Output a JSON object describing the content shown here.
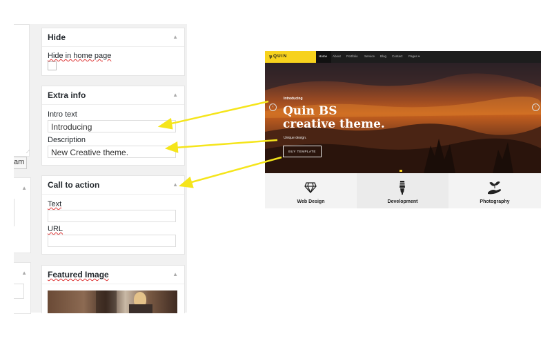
{
  "cut_off_text": "am",
  "metaboxes": {
    "hide": {
      "title": "Hide",
      "checkbox_label": "Hide in home page"
    },
    "extra_info": {
      "title": "Extra info",
      "intro_label": "Intro text",
      "intro_value": "Introducing",
      "description_label": "Description",
      "description_value": "New Creative theme."
    },
    "call_to_action": {
      "title": "Call to action",
      "text_label": "Text",
      "text_value": "",
      "url_label": "URL",
      "url_value": ""
    },
    "featured_image": {
      "title": "Featured Image"
    }
  },
  "preview": {
    "logo": "QUIN",
    "nav": [
      "Home",
      "About",
      "Portfolio",
      "Service",
      "Blog",
      "Contact",
      "Pages ▾"
    ],
    "hero": {
      "kicker": "Introducing",
      "heading_line1": "Quin BS",
      "heading_line2": "creative theme.",
      "subtitle": "Unique design.",
      "button": "BUY TEMPLATE"
    },
    "features": [
      {
        "label": "Web Design",
        "icon": "diamond-icon"
      },
      {
        "label": "Development",
        "icon": "lightbulb-icon"
      },
      {
        "label": "Photography",
        "icon": "plant-in-hand-icon"
      }
    ]
  },
  "colors": {
    "arrow": "#f5e51b",
    "accent": "#f7d21d",
    "nav_bg": "#1d1d1d"
  }
}
